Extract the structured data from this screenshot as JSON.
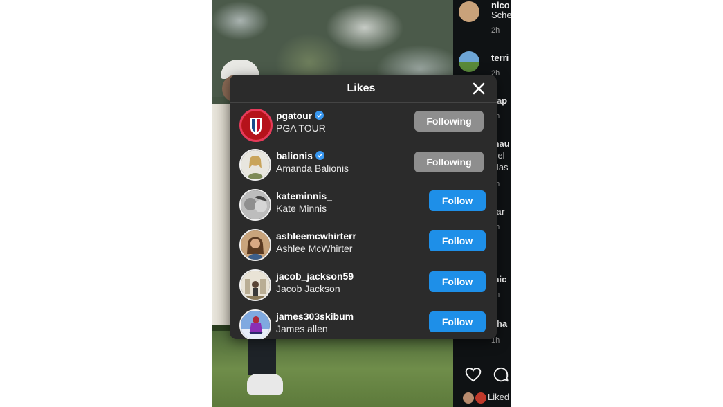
{
  "modal": {
    "title": "Likes",
    "close_icon": "close-icon"
  },
  "users": [
    {
      "username": "pgatour",
      "fullname": "PGA TOUR",
      "verified": true,
      "button": "Following",
      "state": "following"
    },
    {
      "username": "balionis",
      "fullname": "Amanda Balionis",
      "verified": true,
      "button": "Following",
      "state": "following"
    },
    {
      "username": "kateminnis_",
      "fullname": "Kate Minnis",
      "verified": false,
      "button": "Follow",
      "state": "follow"
    },
    {
      "username": "ashleemcwhirterr",
      "fullname": "Ashlee McWhirter",
      "verified": false,
      "button": "Follow",
      "state": "follow"
    },
    {
      "username": "jacob_jackson59",
      "fullname": "Jacob Jackson",
      "verified": false,
      "button": "Follow",
      "state": "follow"
    },
    {
      "username": "james303skibum",
      "fullname": "James allen",
      "verified": false,
      "button": "Follow",
      "state": "follow"
    }
  ],
  "comments": [
    {
      "name": "nico",
      "text": "Sche",
      "time": "2h"
    },
    {
      "name": "terri",
      "text": "",
      "time": "2h"
    },
    {
      "name": "hap",
      "text": "",
      "time": "2h"
    },
    {
      "name": "mau",
      "text": "wel",
      "text2": "Mas",
      "time": "1h"
    },
    {
      "name": "car",
      "text": "",
      "time": "2h"
    },
    {
      "name": "mic",
      "text": "",
      "time": "1h"
    },
    {
      "name": "hha",
      "text": "",
      "time": "1h"
    }
  ],
  "footer": {
    "liked_text": "Liked"
  },
  "colors": {
    "follow_button": "#1e8fe8",
    "following_button": "#8e8e8e",
    "verified_badge": "#3897f0",
    "modal_bg": "#2b2b2b"
  }
}
